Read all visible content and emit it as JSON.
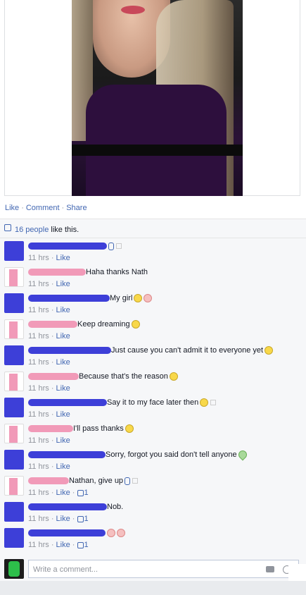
{
  "post_actions": {
    "like": "Like",
    "comment": "Comment",
    "share": "Share",
    "sep": "·"
  },
  "likes": {
    "count_text": "16 people",
    "suffix": " like this."
  },
  "comments": [
    {
      "avatar": "blue",
      "name_color": "blue",
      "text": "",
      "time": "11 hrs",
      "like": "Like",
      "likes": "",
      "extras": [
        "hand-icon",
        "square-icon"
      ]
    },
    {
      "avatar": "white",
      "name_color": "pink",
      "text": "Haha thanks Nath",
      "time": "11 hrs",
      "like": "Like",
      "likes": "",
      "extras": []
    },
    {
      "avatar": "blue",
      "name_color": "blue",
      "text": "My girl",
      "time": "11 hrs",
      "like": "Like",
      "likes": "",
      "extras": [
        "wink-emoji",
        "kiss-emoji"
      ]
    },
    {
      "avatar": "white",
      "name_color": "pink",
      "text": "Keep dreaming",
      "time": "11 hrs",
      "like": "Like",
      "likes": "",
      "extras": [
        "wink-emoji"
      ]
    },
    {
      "avatar": "blue",
      "name_color": "blue",
      "text": "Just cause you can't admit it to everyone yet",
      "time": "11 hrs",
      "like": "Like",
      "likes": "",
      "extras": [
        "embarrassed-emoji"
      ]
    },
    {
      "avatar": "white",
      "name_color": "pink",
      "text": "Because that's the reason",
      "time": "11 hrs",
      "like": "Like",
      "likes": "",
      "extras": [
        "wink-emoji"
      ]
    },
    {
      "avatar": "blue",
      "name_color": "blue",
      "text": "Say it to my face later then",
      "time": "11 hrs",
      "like": "Like",
      "likes": "",
      "extras": [
        "wink-emoji",
        "square-icon"
      ]
    },
    {
      "avatar": "white",
      "name_color": "pink",
      "text": "I'll pass thanks",
      "time": "11 hrs",
      "like": "Like",
      "likes": "",
      "extras": [
        "wink-emoji"
      ]
    },
    {
      "avatar": "blue",
      "name_color": "blue",
      "text": "Sorry, forgot you said don't tell anyone",
      "time": "11 hrs",
      "like": "Like",
      "likes": "",
      "extras": [
        "heart-emoji"
      ]
    },
    {
      "avatar": "white",
      "name_color": "pink",
      "text": "Nathan, give up",
      "time": "11 hrs",
      "like": "Like",
      "likes": "1",
      "extras": [
        "hand-icon",
        "square-icon"
      ]
    },
    {
      "avatar": "blue",
      "name_color": "blue",
      "text": "Nob.",
      "time": "11 hrs",
      "like": "Like",
      "likes": "1",
      "extras": []
    },
    {
      "avatar": "blue",
      "name_color": "blue",
      "text": "",
      "time": "11 hrs",
      "like": "Like",
      "likes": "1",
      "extras": [
        "kiss-emoji",
        "kiss-emoji"
      ]
    }
  ],
  "write_comment": {
    "placeholder": "Write a comment..."
  },
  "colors": {
    "link": "#4267b2",
    "redact_blue": "#3d3fd8",
    "redact_pink": "#f19ab8",
    "meta": "#90949c"
  }
}
